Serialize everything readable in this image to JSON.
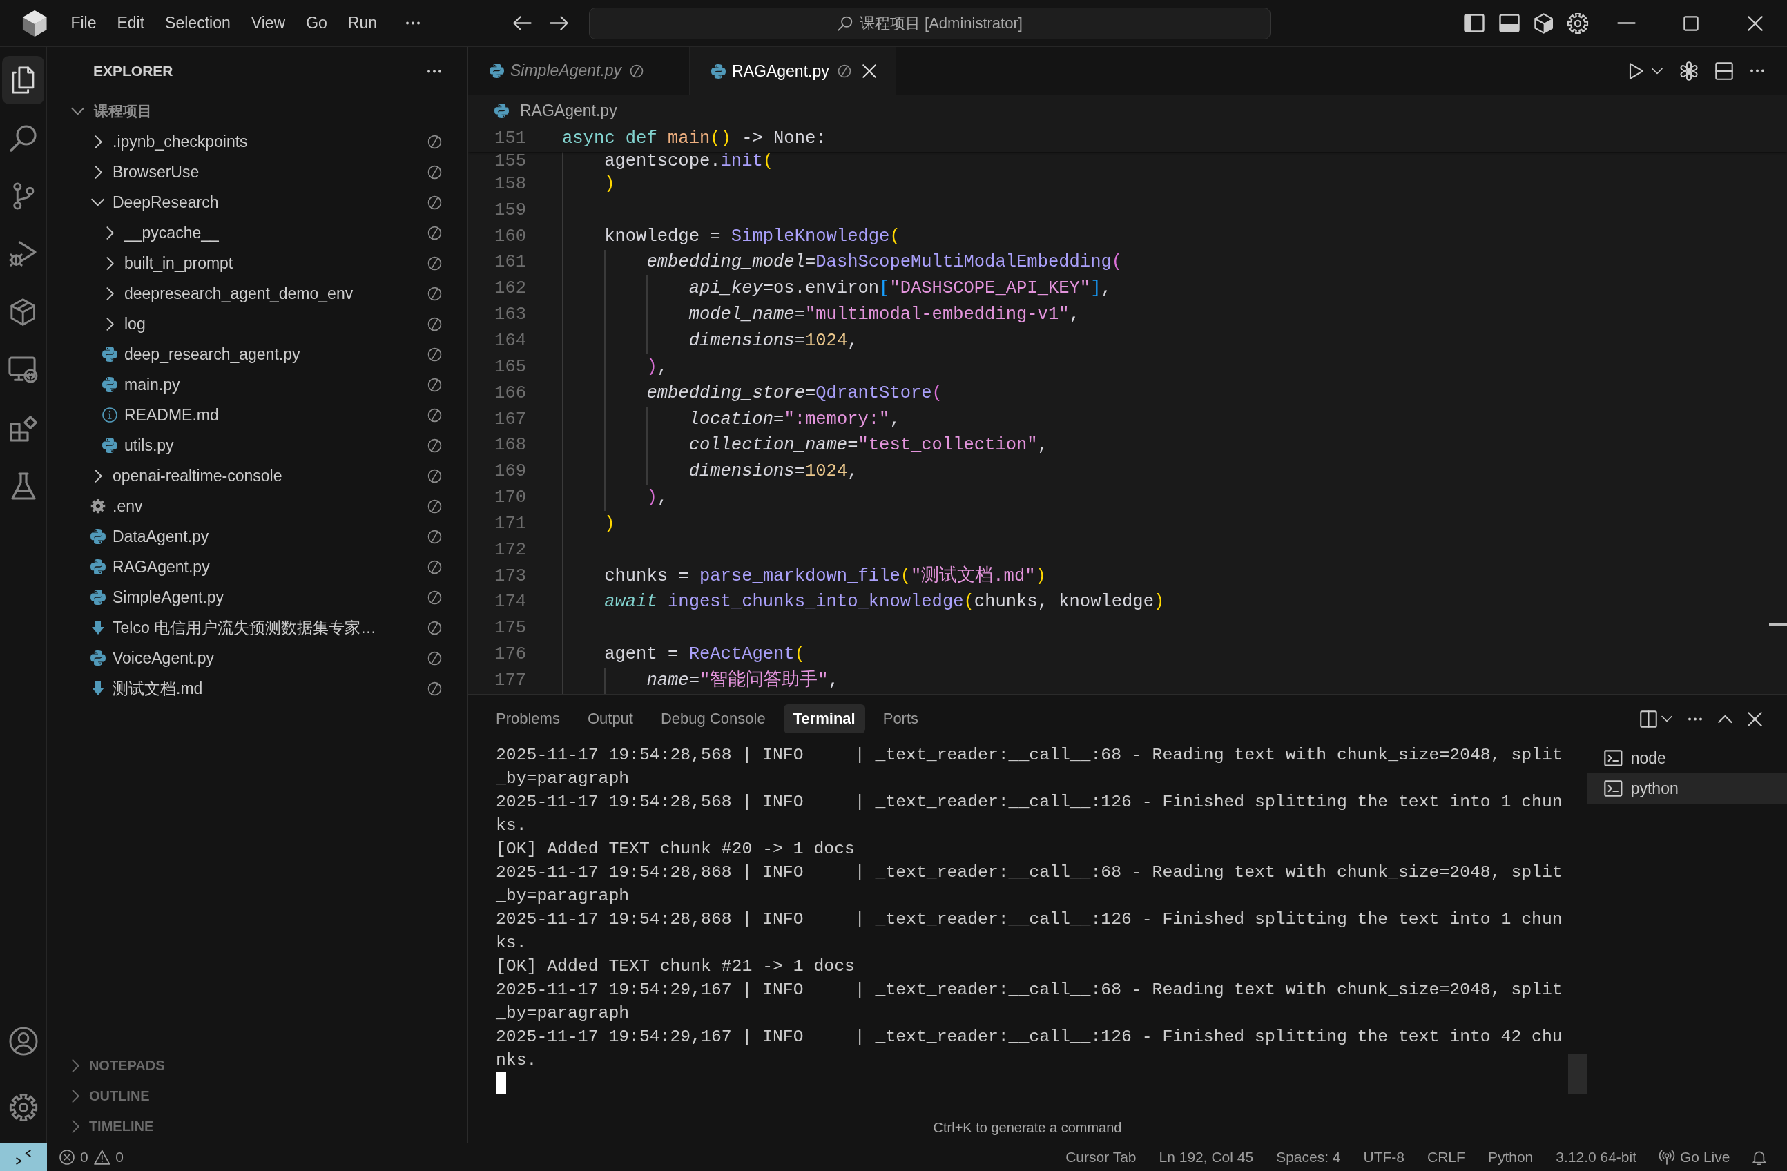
{
  "title_bar": {
    "menu": [
      "File",
      "Edit",
      "Selection",
      "View",
      "Go",
      "Run"
    ],
    "command_center": "课程项目 [Administrator]"
  },
  "activity_bar": {
    "items": [
      {
        "kind": "explorer",
        "selected": true
      },
      {
        "kind": "search",
        "selected": false
      },
      {
        "kind": "source_control",
        "selected": false
      },
      {
        "kind": "run_debug",
        "selected": false
      },
      {
        "kind": "cube",
        "selected": false
      },
      {
        "kind": "remote",
        "selected": false
      },
      {
        "kind": "extensions",
        "selected": false
      },
      {
        "kind": "testing",
        "selected": false
      }
    ],
    "bottom": [
      {
        "kind": "account"
      },
      {
        "kind": "settings"
      }
    ]
  },
  "sidebar": {
    "title": "EXPLORER",
    "root": {
      "name": "课程项目",
      "expanded": true
    },
    "tree": [
      {
        "name": ".ipynb_checkpoints",
        "kind": "folder",
        "expanded": false
      },
      {
        "name": "BrowserUse",
        "kind": "folder",
        "expanded": false
      },
      {
        "name": "DeepResearch",
        "kind": "folder",
        "expanded": true,
        "children": [
          {
            "name": "__pycache__",
            "kind": "folder",
            "expanded": false
          },
          {
            "name": "built_in_prompt",
            "kind": "folder",
            "expanded": false
          },
          {
            "name": "deepresearch_agent_demo_env",
            "kind": "folder",
            "expanded": false
          },
          {
            "name": "log",
            "kind": "folder",
            "expanded": false
          },
          {
            "name": "deep_research_agent.py",
            "kind": "python"
          },
          {
            "name": "main.py",
            "kind": "python"
          },
          {
            "name": "README.md",
            "kind": "readme"
          },
          {
            "name": "utils.py",
            "kind": "python"
          }
        ]
      },
      {
        "name": "openai-realtime-console",
        "kind": "folder",
        "expanded": false
      },
      {
        "name": ".env",
        "kind": "env"
      },
      {
        "name": "DataAgent.py",
        "kind": "python"
      },
      {
        "name": "RAGAgent.py",
        "kind": "python"
      },
      {
        "name": "SimpleAgent.py",
        "kind": "python"
      },
      {
        "name": "Telco 电信用户流失预测数据集专家…",
        "kind": "markdown"
      },
      {
        "name": "VoiceAgent.py",
        "kind": "python"
      },
      {
        "name": "测试文档.md",
        "kind": "markdown"
      }
    ],
    "sections": [
      {
        "name": "NOTEPADS",
        "expanded": false
      },
      {
        "name": "OUTLINE",
        "expanded": false
      },
      {
        "name": "TIMELINE",
        "expanded": false
      }
    ]
  },
  "editor": {
    "tabs": [
      {
        "label": "SimpleAgent.py",
        "selected": false,
        "preview": true
      },
      {
        "label": "RAGAgent.py",
        "selected": true,
        "preview": false
      }
    ],
    "breadcrumb": "RAGAgent.py",
    "sticky_line": {
      "number": "151",
      "tokens": [
        {
          "text": "async",
          "kind": "keyword"
        },
        {
          "text": " def",
          "kind": "keyword"
        },
        {
          "text": " main",
          "kind": "defname"
        },
        {
          "text": "()",
          "kind": "bracket1"
        },
        {
          "text": " -> None:",
          "kind": "plain"
        }
      ]
    },
    "line_below_sticky": {
      "number": "155",
      "tokens": [
        {
          "text": "    agentscope.",
          "kind": "plain"
        },
        {
          "text": "init",
          "kind": "call"
        },
        {
          "text": "(",
          "kind": "bracket1"
        }
      ]
    },
    "lines": [
      {
        "number": "158",
        "tokens": [
          {
            "text": "    )",
            "kind": "bracket1"
          }
        ]
      },
      {
        "number": "159"
      },
      {
        "number": "160",
        "tokens": [
          {
            "text": "    knowledge = ",
            "kind": "plain"
          },
          {
            "text": "SimpleKnowledge",
            "kind": "call"
          },
          {
            "text": "(",
            "kind": "bracket1"
          }
        ]
      },
      {
        "number": "161",
        "tokens": [
          {
            "text": "        embedding_model",
            "kind": "param"
          },
          {
            "text": "=",
            "kind": "plain"
          },
          {
            "text": "DashScopeMultiModalEmbedding",
            "kind": "call"
          },
          {
            "text": "(",
            "kind": "bracket2"
          }
        ]
      },
      {
        "number": "162",
        "tokens": [
          {
            "text": "            api_key",
            "kind": "param"
          },
          {
            "text": "=os.environ",
            "kind": "plain"
          },
          {
            "text": "[",
            "kind": "bracket3"
          },
          {
            "text": "\"DASHSCOPE_API_KEY\"",
            "kind": "string"
          },
          {
            "text": "]",
            "kind": "bracket3"
          },
          {
            "text": ",",
            "kind": "plain"
          }
        ]
      },
      {
        "number": "163",
        "tokens": [
          {
            "text": "            model_name",
            "kind": "param"
          },
          {
            "text": "=",
            "kind": "plain"
          },
          {
            "text": "\"multimodal-embedding-v1\"",
            "kind": "string"
          },
          {
            "text": ",",
            "kind": "plain"
          }
        ]
      },
      {
        "number": "164",
        "tokens": [
          {
            "text": "            dimensions",
            "kind": "param"
          },
          {
            "text": "=",
            "kind": "plain"
          },
          {
            "text": "1024",
            "kind": "number"
          },
          {
            "text": ",",
            "kind": "plain"
          }
        ]
      },
      {
        "number": "165",
        "tokens": [
          {
            "text": "        )",
            "kind": "bracket2"
          },
          {
            "text": ",",
            "kind": "plain"
          }
        ]
      },
      {
        "number": "166",
        "tokens": [
          {
            "text": "        embedding_store",
            "kind": "param"
          },
          {
            "text": "=",
            "kind": "plain"
          },
          {
            "text": "QdrantStore",
            "kind": "call"
          },
          {
            "text": "(",
            "kind": "bracket2"
          }
        ]
      },
      {
        "number": "167",
        "tokens": [
          {
            "text": "            location",
            "kind": "param"
          },
          {
            "text": "=",
            "kind": "plain"
          },
          {
            "text": "\":memory:\"",
            "kind": "string"
          },
          {
            "text": ",",
            "kind": "plain"
          }
        ]
      },
      {
        "number": "168",
        "tokens": [
          {
            "text": "            collection_name",
            "kind": "param"
          },
          {
            "text": "=",
            "kind": "plain"
          },
          {
            "text": "\"test_collection\"",
            "kind": "string"
          },
          {
            "text": ",",
            "kind": "plain"
          }
        ]
      },
      {
        "number": "169",
        "tokens": [
          {
            "text": "            dimensions",
            "kind": "param"
          },
          {
            "text": "=",
            "kind": "plain"
          },
          {
            "text": "1024",
            "kind": "number"
          },
          {
            "text": ",",
            "kind": "plain"
          }
        ]
      },
      {
        "number": "170",
        "tokens": [
          {
            "text": "        )",
            "kind": "bracket2"
          },
          {
            "text": ",",
            "kind": "plain"
          }
        ]
      },
      {
        "number": "171",
        "tokens": [
          {
            "text": "    )",
            "kind": "bracket1"
          }
        ]
      },
      {
        "number": "172"
      },
      {
        "number": "173",
        "tokens": [
          {
            "text": "    chunks = ",
            "kind": "plain"
          },
          {
            "text": "parse_markdown_file",
            "kind": "call"
          },
          {
            "text": "(",
            "kind": "bracket1"
          },
          {
            "text": "\"测试文档.md\"",
            "kind": "string"
          },
          {
            "text": ")",
            "kind": "bracket1"
          }
        ]
      },
      {
        "number": "174",
        "tokens": [
          {
            "text": "    await",
            "kind": "control"
          },
          {
            "text": " ingest_chunks_into_knowledge",
            "kind": "call"
          },
          {
            "text": "(",
            "kind": "bracket1"
          },
          {
            "text": "chunks, knowledge",
            "kind": "plain"
          },
          {
            "text": ")",
            "kind": "bracket1"
          }
        ]
      },
      {
        "number": "175"
      },
      {
        "number": "176",
        "tokens": [
          {
            "text": "    agent = ",
            "kind": "plain"
          },
          {
            "text": "ReActAgent",
            "kind": "call"
          },
          {
            "text": "(",
            "kind": "bracket1"
          }
        ]
      },
      {
        "number": "177",
        "tokens": [
          {
            "text": "        name",
            "kind": "param"
          },
          {
            "text": "=",
            "kind": "plain"
          },
          {
            "text": "\"智能问答助手\"",
            "kind": "string"
          },
          {
            "text": ",",
            "kind": "plain"
          }
        ]
      }
    ]
  },
  "panel": {
    "tabs": [
      {
        "label": "Problems",
        "selected": false
      },
      {
        "label": "Output",
        "selected": false
      },
      {
        "label": "Debug Console",
        "selected": false
      },
      {
        "label": "Terminal",
        "selected": true
      },
      {
        "label": "Ports",
        "selected": false
      }
    ],
    "terminal_lines": [
      "2025-11-17 19:54:28,568 | INFO     | _text_reader:__call__:68 - Reading text with chunk_size=2048, split_by=paragraph",
      "2025-11-17 19:54:28,568 | INFO     | _text_reader:__call__:126 - Finished splitting the text into 1 chunks.",
      "[OK] Added TEXT chunk #20 -> 1 docs",
      "2025-11-17 19:54:28,868 | INFO     | _text_reader:__call__:68 - Reading text with chunk_size=2048, split_by=paragraph",
      "2025-11-17 19:54:28,868 | INFO     | _text_reader:__call__:126 - Finished splitting the text into 1 chunks.",
      "[OK] Added TEXT chunk #21 -> 1 docs",
      "2025-11-17 19:54:29,167 | INFO     | _text_reader:__call__:68 - Reading text with chunk_size=2048, split_by=paragraph",
      "2025-11-17 19:54:29,167 | INFO     | _text_reader:__call__:126 - Finished splitting the text into 42 chunks."
    ],
    "hint": "Ctrl+K to generate a command",
    "terminals": [
      {
        "name": "node",
        "selected": false
      },
      {
        "name": "python",
        "selected": true
      }
    ]
  },
  "status_bar": {
    "errors": "0",
    "warnings": "0",
    "items": [
      "Cursor Tab",
      "Ln 192, Col 45",
      "Spaces: 4",
      "UTF-8",
      "CRLF",
      "Python",
      "3.12.0 64-bit"
    ],
    "go_live": "Go Live"
  }
}
